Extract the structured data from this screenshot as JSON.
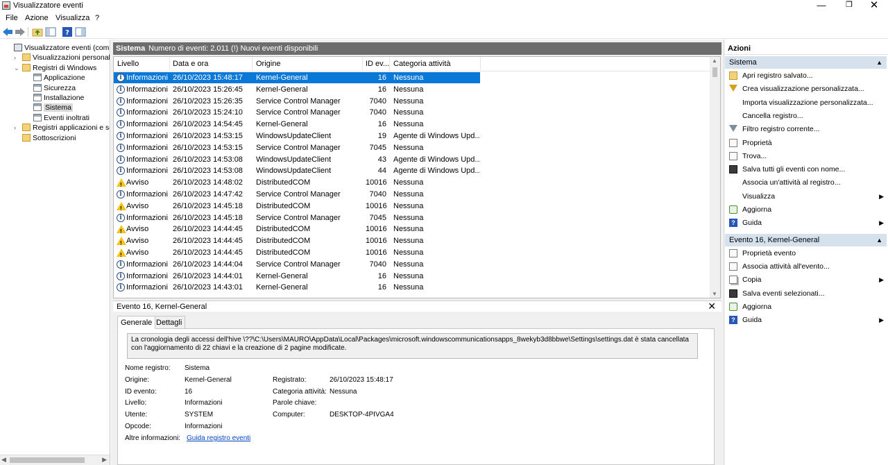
{
  "window": {
    "title": "Visualizzatore eventi",
    "min_glyph": "—",
    "max_glyph": "❐",
    "close_glyph": "✕"
  },
  "menu": [
    "File",
    "Azione",
    "Visualizza",
    "?"
  ],
  "toolbar": {
    "icons": [
      "back-arrow-icon",
      "forward-arrow-icon",
      "folder-up-icon",
      "show-hide-tree-icon",
      "help-icon",
      "show-hide-action-icon"
    ]
  },
  "tree": {
    "items": [
      {
        "label": "Visualizzatore eventi (computer",
        "indent": 0,
        "expander": "",
        "icon": "pc"
      },
      {
        "label": "Visualizzazioni personalizzate",
        "indent": 1,
        "expander": "›",
        "icon": "folder"
      },
      {
        "label": "Registri di Windows",
        "indent": 1,
        "expander": "⌄",
        "icon": "folder"
      },
      {
        "label": "Applicazione",
        "indent": 2,
        "expander": "",
        "icon": "log"
      },
      {
        "label": "Sicurezza",
        "indent": 2,
        "expander": "",
        "icon": "log"
      },
      {
        "label": "Installazione",
        "indent": 2,
        "expander": "",
        "icon": "log"
      },
      {
        "label": "Sistema",
        "indent": 2,
        "expander": "",
        "icon": "log",
        "selected": true
      },
      {
        "label": "Eventi inoltrati",
        "indent": 2,
        "expander": "",
        "icon": "log"
      },
      {
        "label": "Registri applicazioni e servizi",
        "indent": 1,
        "expander": "›",
        "icon": "folder"
      },
      {
        "label": "Sottoscrizioni",
        "indent": 1,
        "expander": "",
        "icon": "folder"
      }
    ]
  },
  "center": {
    "header_title": "Sistema",
    "header_info": "Numero di eventi: 2.011 (!) Nuovi eventi disponibili",
    "columns": [
      "Livello",
      "Data e ora",
      "Origine",
      "ID ev...",
      "Categoria attività"
    ],
    "rows": [
      {
        "level": "Informazioni",
        "type": "info",
        "date": "26/10/2023 15:48:17",
        "source": "Kernel-General",
        "id": "16",
        "category": "Nessuna",
        "selected": true
      },
      {
        "level": "Informazioni",
        "type": "info",
        "date": "26/10/2023 15:26:45",
        "source": "Kernel-General",
        "id": "16",
        "category": "Nessuna"
      },
      {
        "level": "Informazioni",
        "type": "info",
        "date": "26/10/2023 15:26:35",
        "source": "Service Control Manager",
        "id": "7040",
        "category": "Nessuna"
      },
      {
        "level": "Informazioni",
        "type": "info",
        "date": "26/10/2023 15:24:10",
        "source": "Service Control Manager",
        "id": "7040",
        "category": "Nessuna"
      },
      {
        "level": "Informazioni",
        "type": "info",
        "date": "26/10/2023 14:54:45",
        "source": "Kernel-General",
        "id": "16",
        "category": "Nessuna"
      },
      {
        "level": "Informazioni",
        "type": "info",
        "date": "26/10/2023 14:53:15",
        "source": "WindowsUpdateClient",
        "id": "19",
        "category": "Agente di Windows Upd..."
      },
      {
        "level": "Informazioni",
        "type": "info",
        "date": "26/10/2023 14:53:15",
        "source": "Service Control Manager",
        "id": "7045",
        "category": "Nessuna"
      },
      {
        "level": "Informazioni",
        "type": "info",
        "date": "26/10/2023 14:53:08",
        "source": "WindowsUpdateClient",
        "id": "43",
        "category": "Agente di Windows Upd..."
      },
      {
        "level": "Informazioni",
        "type": "info",
        "date": "26/10/2023 14:53:08",
        "source": "WindowsUpdateClient",
        "id": "44",
        "category": "Agente di Windows Upd..."
      },
      {
        "level": "Avviso",
        "type": "warn",
        "date": "26/10/2023 14:48:02",
        "source": "DistributedCOM",
        "id": "10016",
        "category": "Nessuna"
      },
      {
        "level": "Informazioni",
        "type": "info",
        "date": "26/10/2023 14:47:42",
        "source": "Service Control Manager",
        "id": "7040",
        "category": "Nessuna"
      },
      {
        "level": "Avviso",
        "type": "warn",
        "date": "26/10/2023 14:45:18",
        "source": "DistributedCOM",
        "id": "10016",
        "category": "Nessuna"
      },
      {
        "level": "Informazioni",
        "type": "info",
        "date": "26/10/2023 14:45:18",
        "source": "Service Control Manager",
        "id": "7045",
        "category": "Nessuna"
      },
      {
        "level": "Avviso",
        "type": "warn",
        "date": "26/10/2023 14:44:45",
        "source": "DistributedCOM",
        "id": "10016",
        "category": "Nessuna"
      },
      {
        "level": "Avviso",
        "type": "warn",
        "date": "26/10/2023 14:44:45",
        "source": "DistributedCOM",
        "id": "10016",
        "category": "Nessuna"
      },
      {
        "level": "Avviso",
        "type": "warn",
        "date": "26/10/2023 14:44:45",
        "source": "DistributedCOM",
        "id": "10016",
        "category": "Nessuna"
      },
      {
        "level": "Informazioni",
        "type": "info",
        "date": "26/10/2023 14:44:04",
        "source": "Service Control Manager",
        "id": "7040",
        "category": "Nessuna"
      },
      {
        "level": "Informazioni",
        "type": "info",
        "date": "26/10/2023 14:44:01",
        "source": "Kernel-General",
        "id": "16",
        "category": "Nessuna"
      },
      {
        "level": "Informazioni",
        "type": "info",
        "date": "26/10/2023 14:43:01",
        "source": "Kernel-General",
        "id": "16",
        "category": "Nessuna"
      }
    ]
  },
  "detail": {
    "title": "Evento 16, Kernel-General",
    "close_glyph": "✕",
    "tabs": [
      "Generale",
      "Dettagli"
    ],
    "description": "La cronologia degli accessi dell'hive \\??\\C:\\Users\\MAURO\\AppData\\Local\\Packages\\microsoft.windowscommunicationsapps_8wekyb3d8bbwe\\Settings\\settings.dat è stata cancellata con l'aggiornamento di 22 chiavi e la creazione di 2 pagine modificate.",
    "fields": {
      "log_name_label": "Nome registro:",
      "log_name": "Sistema",
      "source_label": "Origine:",
      "source": "Kernel-General",
      "logged_label": "Registrato:",
      "logged": "26/10/2023 15:48:17",
      "event_id_label": "ID evento:",
      "event_id": "16",
      "category_label": "Categoria attività:",
      "category": "Nessuna",
      "level_label": "Livello:",
      "level": "Informazioni",
      "keywords_label": "Parole chiave:",
      "keywords": "",
      "user_label": "Utente:",
      "user": "SYSTEM",
      "computer_label": "Computer:",
      "computer": "DESKTOP-4PIVGA4",
      "opcode_label": "Opcode:",
      "opcode": "Informazioni",
      "more_info_label": "Altre informazioni:",
      "more_info_link": "Guida registro eventi"
    }
  },
  "actions": {
    "title": "Azioni",
    "sections": [
      {
        "title": "Sistema",
        "items": [
          {
            "label": "Apri registro salvato...",
            "icon": "open",
            "icon_name": "open-folder-icon"
          },
          {
            "label": "Crea visualizzazione personalizzata...",
            "icon": "filter",
            "icon_name": "filter-create-icon"
          },
          {
            "label": "Importa visualizzazione personalizzata...",
            "icon": "none",
            "icon_name": "import-icon"
          },
          {
            "label": "Cancella registro...",
            "icon": "none",
            "icon_name": "clear-log-icon"
          },
          {
            "label": "Filtro registro corrente...",
            "icon": "filter-grey",
            "icon_name": "filter-icon"
          },
          {
            "label": "Proprietà",
            "icon": "doc",
            "icon_name": "properties-icon"
          },
          {
            "label": "Trova...",
            "icon": "doc",
            "icon_name": "find-icon"
          },
          {
            "label": "Salva tutti gli eventi con nome...",
            "icon": "save",
            "icon_name": "save-icon"
          },
          {
            "label": "Associa un'attività al registro...",
            "icon": "none",
            "icon_name": "attach-task-icon"
          },
          {
            "label": "Visualizza",
            "icon": "none",
            "icon_name": "view-icon",
            "arrow": "▶"
          },
          {
            "label": "Aggiorna",
            "icon": "refresh",
            "icon_name": "refresh-icon"
          },
          {
            "label": "Guida",
            "icon": "help",
            "icon_name": "help-icon",
            "arrow": "▶"
          }
        ]
      },
      {
        "title": "Evento 16, Kernel-General",
        "items": [
          {
            "label": "Proprietà evento",
            "icon": "doc",
            "icon_name": "event-properties-icon"
          },
          {
            "label": "Associa attività all'evento...",
            "icon": "doc",
            "icon_name": "attach-task-event-icon"
          },
          {
            "label": "Copia",
            "icon": "copy",
            "icon_name": "copy-icon",
            "arrow": "▶"
          },
          {
            "label": "Salva eventi selezionati...",
            "icon": "save",
            "icon_name": "save-selected-icon"
          },
          {
            "label": "Aggiorna",
            "icon": "refresh",
            "icon_name": "refresh-icon"
          },
          {
            "label": "Guida",
            "icon": "help",
            "icon_name": "help-icon",
            "arrow": "▶"
          }
        ]
      }
    ],
    "collapse_glyph": "▲"
  },
  "colors": {
    "selection": "#0a78d7",
    "header_bar": "#6d6d6d",
    "section_bg": "#d6e1ee",
    "link": "#0046c8",
    "warning": "#f3c21b"
  }
}
